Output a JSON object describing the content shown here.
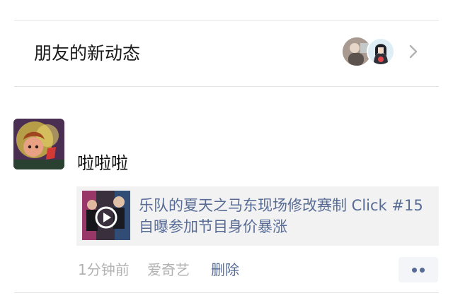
{
  "friends_section": {
    "title": "朋友的新动态",
    "avatars": [
      "friend-avatar-1",
      "friend-avatar-2"
    ],
    "chevron_icon": "chevron-right-icon"
  },
  "post": {
    "text": "啦啦啦",
    "link": {
      "title": "乐队的夏天之马东现场修改赛制 Click #15自曝参加节目身价暴涨",
      "thumbnail_icon": "play-icon"
    },
    "time": "1分钟前",
    "source": "爱奇艺",
    "delete_label": "删除",
    "more_icon": "more-dots-icon"
  },
  "colors": {
    "link_blue": "#576b95",
    "meta_gray": "#b2b2b2",
    "card_bg": "#f2f2f2"
  }
}
